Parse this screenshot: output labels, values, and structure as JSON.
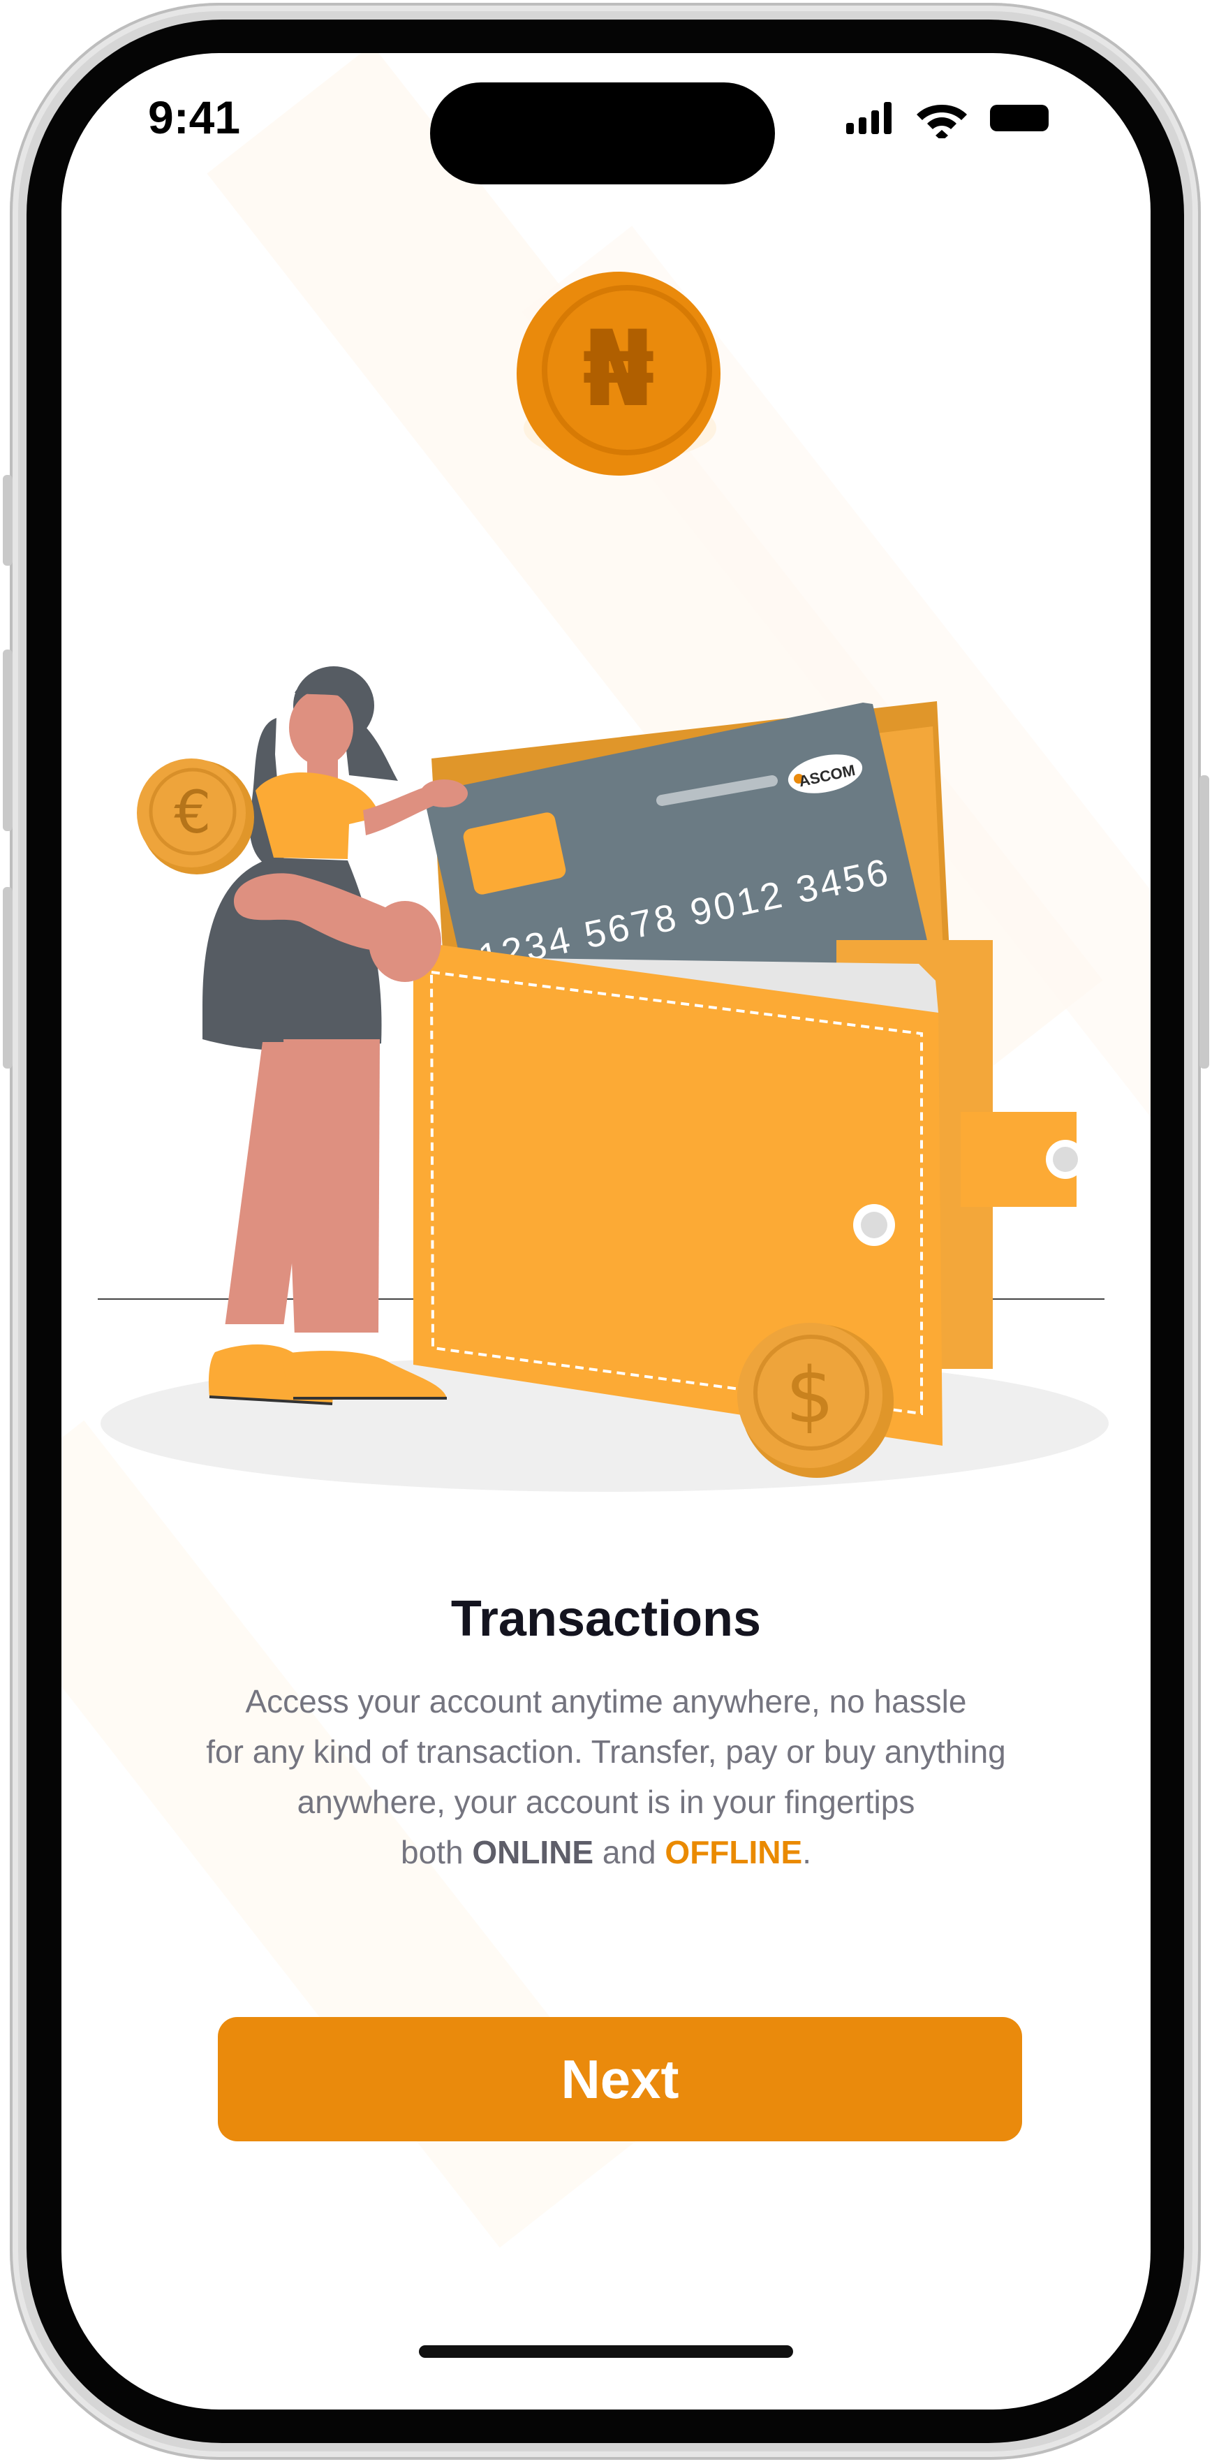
{
  "status_bar": {
    "time": "9:41"
  },
  "illustration": {
    "top_coin_symbol": "₦",
    "left_coin_symbol": "€",
    "bottom_coin_symbol": "$",
    "card_brand": "ASCOM",
    "card_number": "1234 5678 9012 3456"
  },
  "onboarding": {
    "title": "Transactions",
    "description_lines": [
      "Access your account anytime anywhere, no hassle",
      "for any kind of transaction. Transfer, pay or buy anything",
      "anywhere, your account is in your fingertips"
    ],
    "last_line": {
      "prefix": "both ",
      "online": "ONLINE",
      "middle": " and ",
      "offline": "OFFLINE",
      "suffix": "."
    },
    "next_button": "Next"
  },
  "colors": {
    "accent": "#ea8a0c",
    "title": "#14141f",
    "body_text": "#74747f",
    "card_gray": "#6b7b84",
    "wallet_orange": "#fcaa35"
  },
  "icons": [
    "cellular-signal-icon",
    "wifi-icon",
    "battery-icon"
  ]
}
